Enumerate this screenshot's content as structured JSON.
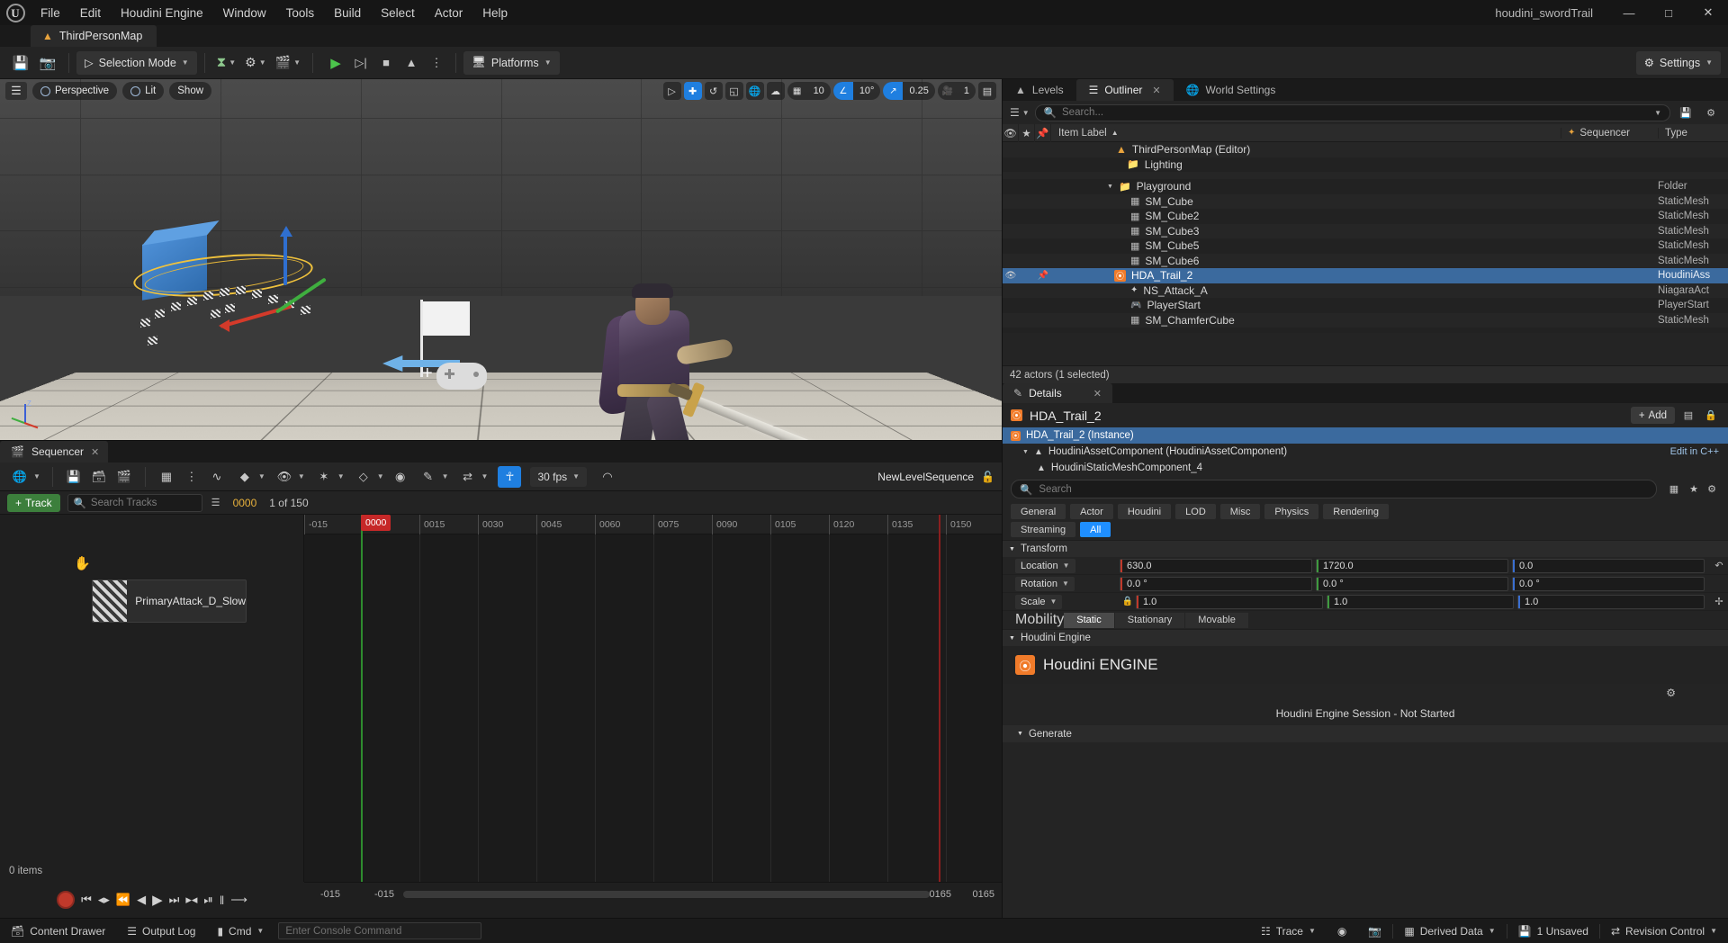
{
  "window": {
    "project_name": "houdini_swordTrail",
    "minimize": "—",
    "maximize": "□",
    "close": "✕"
  },
  "menu": {
    "items": [
      "File",
      "Edit",
      "Houdini Engine",
      "Window",
      "Tools",
      "Build",
      "Select",
      "Actor",
      "Help"
    ]
  },
  "level_tab": {
    "label": "ThirdPersonMap",
    "icon": "map-icon"
  },
  "toolbar": {
    "save_icon": "save-icon",
    "browse_icon": "browse-content-icon",
    "selection_mode": "Selection Mode",
    "create_icon": "add-actor-icon",
    "blueprints_icon": "blueprints-icon",
    "cinematics_icon": "cinematics-icon",
    "play_icon": "play-icon",
    "step_icon": "skip-icon",
    "stop_icon": "stop-icon",
    "eject_icon": "eject-icon",
    "more_icon": "more-options-icon",
    "platforms": "Platforms",
    "settings": "Settings"
  },
  "viewport": {
    "perspective": "Perspective",
    "lit": "Lit",
    "show": "Show",
    "grid_snap_value": "10",
    "angle_snap_value": "10°",
    "scale_snap_value": "0.25",
    "camera_speed_value": "1",
    "tools": [
      "select-icon",
      "translate-icon",
      "rotate-icon",
      "scale-icon",
      "world-coords-icon",
      "surface-snap-icon"
    ],
    "layout_icon": "viewport-layout-icon",
    "axis_labels": {
      "z": "Z"
    }
  },
  "sequencer": {
    "tab_label": "Sequencer",
    "close_icon": "close-icon",
    "sequence_name": "NewLevelSequence",
    "lock_icon": "unlock-icon",
    "fps": "30 fps",
    "add_track": "Track",
    "search_placeholder": "Search Tracks",
    "current_frame": "0000",
    "frame_of": "1 of 150",
    "playhead_label": "0000",
    "items_count": "0 items",
    "track_name": "PrimaryAttack_D_Slow",
    "range_start": "-015",
    "range_end": "0165",
    "ruler_ticks": [
      "-015",
      "0015",
      "0030",
      "0045",
      "0060",
      "0075",
      "0090",
      "0105",
      "0120",
      "0135",
      "0150"
    ],
    "toolbar_icons": [
      "world-icon",
      "save-icon",
      "save-as-icon",
      "render-icon",
      "table-icon",
      "options-icon",
      "curve-icon",
      "key-icon",
      "eye-icon",
      "sparkle-icon",
      "transform-icon",
      "snap-icon",
      "paint-icon",
      "magnet-icon",
      "region-icon"
    ],
    "transport_icons": [
      "record-icon",
      "jump-to-start-icon",
      "previous-key-icon",
      "step-back-icon",
      "reverse-icon",
      "play-icon",
      "step-forward-icon",
      "next-key-icon",
      "jump-to-end-icon",
      "loop-icon",
      "forward-icon"
    ]
  },
  "panel_tabs": {
    "levels": "Levels",
    "outliner": "Outliner",
    "world_settings": "World Settings"
  },
  "outliner": {
    "search_placeholder": "Search...",
    "settings_icon": "settings-icon",
    "save_icon": "save-icon",
    "columns": {
      "item_label": "Item Label",
      "sequencer": "Sequencer",
      "type": "Type"
    },
    "sort_arrow": "▲",
    "rows": [
      {
        "label": "ThirdPersonMap (Editor)",
        "type": "",
        "icon": "map-icon",
        "indent": 1,
        "selected": false
      },
      {
        "label": "Lighting",
        "type": "",
        "icon": "folder-icon",
        "indent": 2,
        "selected": false
      },
      {
        "label": "Playground",
        "type": "Folder",
        "icon": "folder-icon",
        "indent": 2,
        "selected": false,
        "expander": "▼"
      },
      {
        "label": "SM_Cube",
        "type": "StaticMesh",
        "icon": "mesh-icon",
        "indent": 3,
        "selected": false
      },
      {
        "label": "SM_Cube2",
        "type": "StaticMesh",
        "icon": "mesh-icon",
        "indent": 3,
        "selected": false
      },
      {
        "label": "SM_Cube3",
        "type": "StaticMesh",
        "icon": "mesh-icon",
        "indent": 3,
        "selected": false
      },
      {
        "label": "SM_Cube5",
        "type": "StaticMesh",
        "icon": "mesh-icon",
        "indent": 3,
        "selected": false
      },
      {
        "label": "SM_Cube6",
        "type": "StaticMesh",
        "icon": "mesh-icon",
        "indent": 3,
        "selected": false
      },
      {
        "label": "HDA_Trail_2",
        "type": "HoudiniAss",
        "icon": "houdini-icon",
        "indent": 3,
        "selected": true
      },
      {
        "label": "NS_Attack_A",
        "type": "NiagaraAct",
        "icon": "niagara-icon",
        "indent": 3,
        "selected": false
      },
      {
        "label": "PlayerStart",
        "type": "PlayerStart",
        "icon": "playerstart-icon",
        "indent": 3,
        "selected": false
      },
      {
        "label": "SM_ChamferCube",
        "type": "StaticMesh",
        "icon": "mesh-icon",
        "indent": 3,
        "selected": false
      }
    ],
    "actor_count": "42 actors (1 selected)"
  },
  "details": {
    "tab_label": "Details",
    "close_icon": "close-icon",
    "actor_name": "HDA_Trail_2",
    "add_label": "Add",
    "components": [
      {
        "label": "HDA_Trail_2 (Instance)",
        "level": 1,
        "selected": true,
        "icon": "houdini-icon"
      },
      {
        "label": "HoudiniAssetComponent (HoudiniAssetComponent)",
        "level": 2,
        "selected": false,
        "icon": "houdini-component-icon",
        "expander": "▼",
        "edit": "Edit in C++"
      },
      {
        "label": "HoudiniStaticMeshComponent_4",
        "level": 3,
        "selected": false,
        "icon": "houdini-component-icon"
      }
    ],
    "search_placeholder": "Search",
    "filter_tabs": [
      "General",
      "Actor",
      "Houdini",
      "LOD",
      "Misc",
      "Physics",
      "Rendering"
    ],
    "filter_tabs2": [
      {
        "label": "Streaming",
        "active": false
      },
      {
        "label": "All",
        "active": true
      }
    ],
    "transform": {
      "header": "Transform",
      "rows": [
        {
          "label": "Location",
          "x": "630.0",
          "y": "1720.0",
          "z": "0.0"
        },
        {
          "label": "Rotation",
          "x": "0.0 °",
          "y": "0.0 °",
          "z": "0.0 °"
        },
        {
          "label": "Scale",
          "x": "1.0",
          "y": "1.0",
          "z": "1.0"
        }
      ],
      "mobility_label": "Mobility",
      "mobility_options": [
        {
          "label": "Static",
          "active": true
        },
        {
          "label": "Stationary",
          "active": false
        },
        {
          "label": "Movable",
          "active": false
        }
      ]
    },
    "houdini": {
      "header": "Houdini Engine",
      "banner_title": "Houdini ENGINE",
      "session_status": "Houdini Engine Session - Not Started",
      "generate_header": "Generate"
    }
  },
  "statusbar": {
    "content_drawer": "Content Drawer",
    "output_log": "Output Log",
    "cmd": "Cmd",
    "console_placeholder": "Enter Console Command",
    "trace": "Trace",
    "derived_data": "Derived Data",
    "unsaved": "1 Unsaved",
    "revision_control": "Revision Control"
  },
  "colors": {
    "accent_blue": "#1f8fff",
    "selection_blue": "#3b6a9e",
    "houdini_orange": "#f07b2a",
    "green": "#3c7f3c",
    "playhead_red": "#c62828"
  }
}
